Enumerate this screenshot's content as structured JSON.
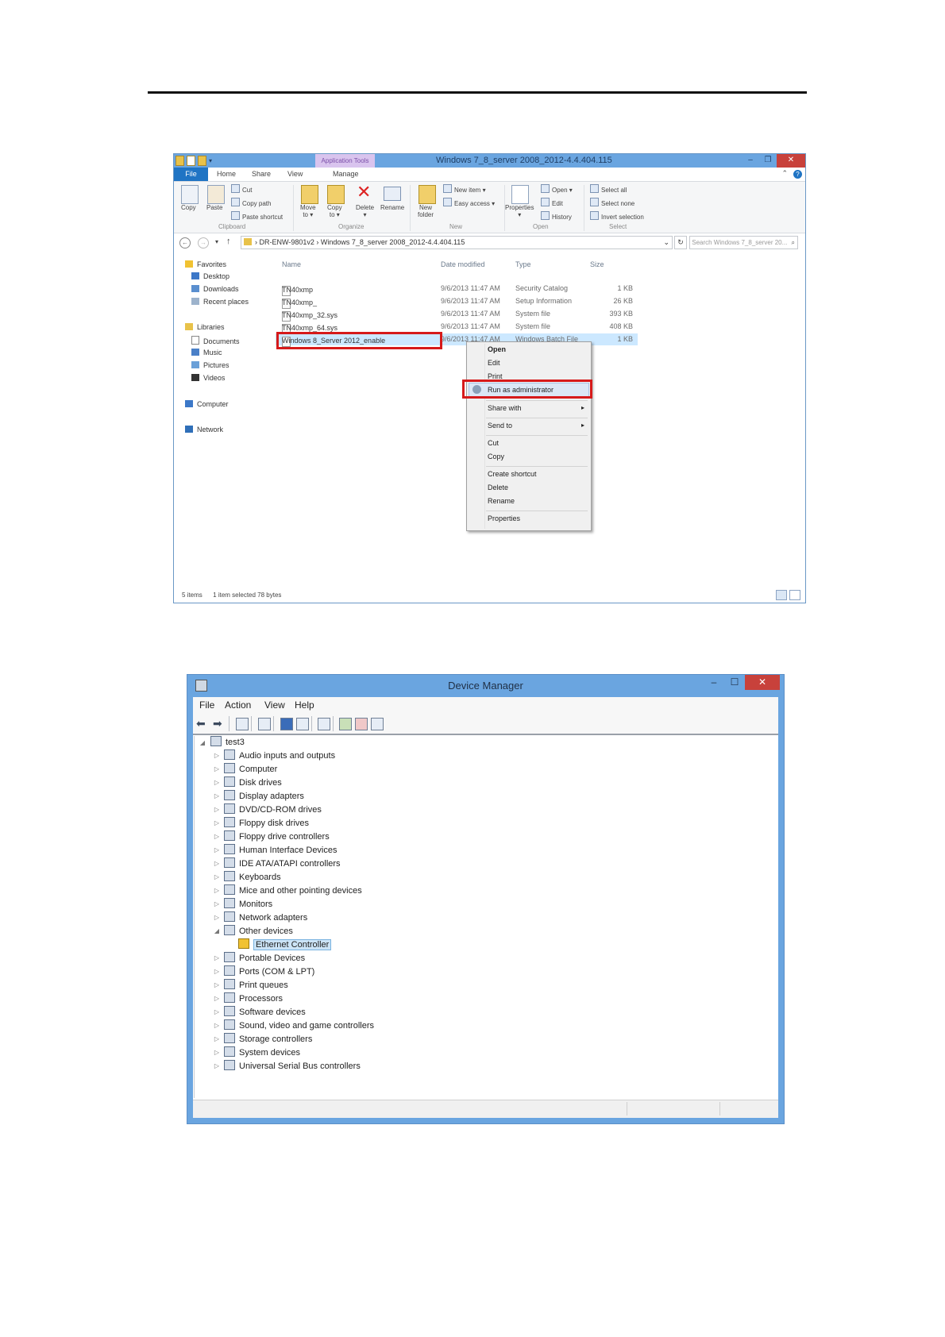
{
  "explorer": {
    "window_title": "Windows 7_8_server 2008_2012-4.4.404.115",
    "contextual_tab": "Application Tools",
    "tabs": [
      "File",
      "Home",
      "Share",
      "View",
      "Manage"
    ],
    "ribbon": {
      "clipboard": {
        "copy": "Copy",
        "paste": "Paste",
        "cut": "Cut",
        "copy_path": "Copy path",
        "paste_shortcut": "Paste shortcut",
        "group": "Clipboard"
      },
      "organize": {
        "move_to": "Move",
        "move_to2": "to ▾",
        "copy_to": "Copy",
        "copy_to2": "to ▾",
        "delete": "Delete",
        "delete2": "▾",
        "rename": "Rename",
        "group": "Organize"
      },
      "new": {
        "new_item": "New item ▾",
        "easy_access": "Easy access ▾",
        "new_folder": "New",
        "new_folder2": "folder",
        "group": "New"
      },
      "open": {
        "properties": "Properties",
        "properties2": "▾",
        "open": "Open ▾",
        "edit": "Edit",
        "history": "History",
        "group": "Open"
      },
      "select": {
        "select_all": "Select all",
        "select_none": "Select none",
        "invert": "Invert selection",
        "group": "Select"
      }
    },
    "address": {
      "crumb1": "DR-ENW-9801v2",
      "crumb2": "Windows 7_8_server 2008_2012-4.4.404.115",
      "search_placeholder": "Search Windows 7_8_server 20..."
    },
    "nav": {
      "favorites": "Favorites",
      "desktop": "Desktop",
      "downloads": "Downloads",
      "recent": "Recent places",
      "libraries": "Libraries",
      "documents": "Documents",
      "music": "Music",
      "pictures": "Pictures",
      "videos": "Videos",
      "computer": "Computer",
      "network": "Network"
    },
    "columns": {
      "name": "Name",
      "date": "Date modified",
      "type": "Type",
      "size": "Size"
    },
    "files": [
      {
        "name": "TN40xmp",
        "date": "9/6/2013 11:47 AM",
        "type": "Security Catalog",
        "size": "1 KB"
      },
      {
        "name": "TN40xmp_",
        "date": "9/6/2013 11:47 AM",
        "type": "Setup Information",
        "size": "26 KB"
      },
      {
        "name": "TN40xmp_32.sys",
        "date": "9/6/2013 11:47 AM",
        "type": "System file",
        "size": "393 KB"
      },
      {
        "name": "TN40xmp_64.sys",
        "date": "9/6/2013 11:47 AM",
        "type": "System file",
        "size": "408 KB"
      },
      {
        "name": "Windows 8_Server 2012_enable",
        "date": "9/6/2013 11:47 AM",
        "type": "Windows Batch File",
        "size": "1 KB"
      }
    ],
    "context_menu": {
      "open": "Open",
      "edit": "Edit",
      "print": "Print",
      "run_as_admin": "Run as administrator",
      "share_with": "Share with",
      "send_to": "Send to",
      "cut": "Cut",
      "copy": "Copy",
      "create_shortcut": "Create shortcut",
      "delete": "Delete",
      "rename": "Rename",
      "properties": "Properties"
    },
    "status": {
      "items": "5 items",
      "selected": "1 item selected  78 bytes"
    }
  },
  "device_manager": {
    "title": "Device Manager",
    "menu": [
      "File",
      "Action",
      "View",
      "Help"
    ],
    "root": "test3",
    "categories": [
      "Audio inputs and outputs",
      "Computer",
      "Disk drives",
      "Display adapters",
      "DVD/CD-ROM drives",
      "Floppy disk drives",
      "Floppy drive controllers",
      "Human Interface Devices",
      "IDE ATA/ATAPI controllers",
      "Keyboards",
      "Mice and other pointing devices",
      "Monitors",
      "Network adapters",
      "Other devices",
      "Portable Devices",
      "Ports (COM & LPT)",
      "Print queues",
      "Processors",
      "Software devices",
      "Sound, video and game controllers",
      "Storage controllers",
      "System devices",
      "Universal Serial Bus controllers"
    ],
    "other_devices_child": "Ethernet Controller"
  }
}
